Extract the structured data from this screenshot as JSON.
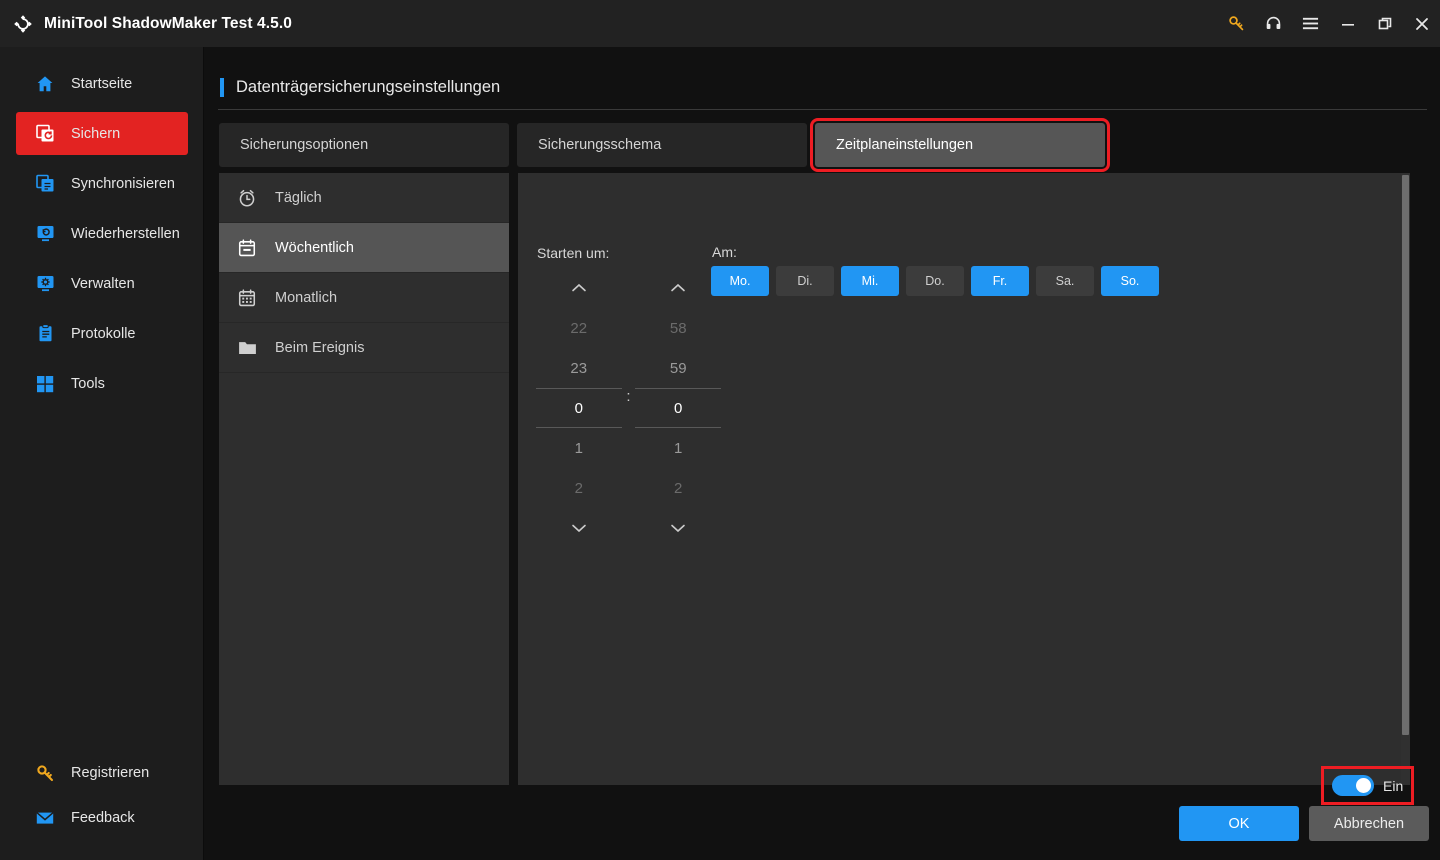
{
  "window": {
    "title": "MiniTool ShadowMaker Test 4.5.0",
    "logo_icon": "shadowmaker-logo-icon",
    "controls": [
      {
        "name": "key-icon",
        "label": "",
        "color": "#f0a81e"
      },
      {
        "name": "headset-icon",
        "label": "",
        "color": "#e8e8e8"
      },
      {
        "name": "hamburger-menu-icon",
        "label": "",
        "color": "#e8e8e8"
      },
      {
        "name": "minimize-icon",
        "label": "",
        "color": "#e8e8e8"
      },
      {
        "name": "maximize-restore-icon",
        "label": "",
        "color": "#e8e8e8"
      },
      {
        "name": "close-icon",
        "label": "",
        "color": "#e8e8e8"
      }
    ]
  },
  "sidebar": {
    "items": [
      {
        "label": "Startseite",
        "icon": "home-icon",
        "active": false
      },
      {
        "label": "Sichern",
        "icon": "backup-icon",
        "active": true
      },
      {
        "label": "Synchronisieren",
        "icon": "sync-icon",
        "active": false
      },
      {
        "label": "Wiederherstellen",
        "icon": "restore-icon",
        "active": false
      },
      {
        "label": "Verwalten",
        "icon": "manage-icon",
        "active": false
      },
      {
        "label": "Protokolle",
        "icon": "logs-icon",
        "active": false
      },
      {
        "label": "Tools",
        "icon": "tools-icon",
        "active": false
      }
    ],
    "bottom_items": [
      {
        "label": "Registrieren",
        "icon": "key-icon"
      },
      {
        "label": "Feedback",
        "icon": "mail-icon"
      }
    ],
    "active_color": "#e32322",
    "icon_color": "#2196f3"
  },
  "page": {
    "title": "Datenträgersicherungseinstellungen",
    "accent_color": "#2196f3"
  },
  "tabs": [
    {
      "label": "Sicherungsoptionen",
      "active": false,
      "annotated": false
    },
    {
      "label": "Sicherungsschema",
      "active": false,
      "annotated": false
    },
    {
      "label": "Zeitplaneinstellungen",
      "active": true,
      "annotated": true
    }
  ],
  "schedule_types": [
    {
      "label": "Täglich",
      "icon": "alarm-clock-icon",
      "selected": false
    },
    {
      "label": "Wöchentlich",
      "icon": "calendar-week-icon",
      "selected": true
    },
    {
      "label": "Monatlich",
      "icon": "calendar-month-icon",
      "selected": false
    },
    {
      "label": "Beim Ereignis",
      "icon": "folder-icon",
      "selected": false
    }
  ],
  "detail": {
    "start_label": "Starten um:",
    "on_label": "Am:",
    "time_separator": ":",
    "hours": {
      "above_far": "22",
      "above": "23",
      "current": "0",
      "below": "1",
      "below_far": "2",
      "up_arrow": "chevron-up-icon",
      "down_arrow": "chevron-down-icon"
    },
    "minutes": {
      "above_far": "58",
      "above": "59",
      "current": "0",
      "below": "1",
      "below_far": "2",
      "up_arrow": "chevron-up-icon",
      "down_arrow": "chevron-down-icon"
    },
    "days": [
      {
        "label": "Mo.",
        "selected": true
      },
      {
        "label": "Di.",
        "selected": false
      },
      {
        "label": "Mi.",
        "selected": true
      },
      {
        "label": "Do.",
        "selected": false
      },
      {
        "label": "Fr.",
        "selected": true
      },
      {
        "label": "Sa.",
        "selected": false
      },
      {
        "label": "So.",
        "selected": true
      }
    ],
    "selected_color": "#2196f3"
  },
  "footer": {
    "toggle_label": "Ein",
    "toggle_state": "on",
    "toggle_annotated": true,
    "ok_label": "OK",
    "cancel_label": "Abbrechen"
  },
  "annotation": {
    "color": "#ee1d23"
  }
}
